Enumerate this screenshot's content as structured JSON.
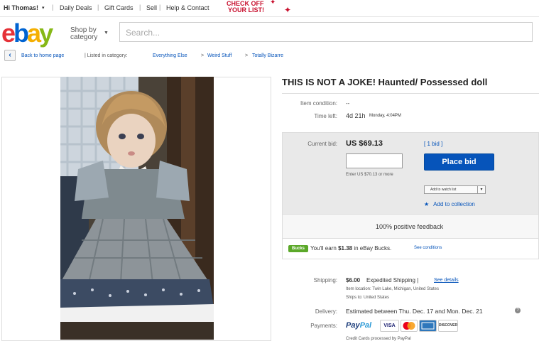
{
  "topbar": {
    "greeting": "Hi Thomas!",
    "greeting_caret": "▾",
    "links": [
      "Daily Deals",
      "Gift Cards",
      "Sell",
      "Help & Contact"
    ],
    "promo_line1": "CHECK OFF",
    "promo_line2": "YOUR LIST!"
  },
  "header": {
    "logo_letters": [
      "e",
      "b",
      "a",
      "y"
    ],
    "logo_colors": [
      "#e53238",
      "#0064d2",
      "#f5af02",
      "#86b817"
    ],
    "shop_by_line1": "Shop by",
    "shop_by_line2": "category",
    "search_placeholder": "Search..."
  },
  "breadcrumb": {
    "back_label": "Back to home page",
    "listed_label": "| Listed in category:",
    "categories": [
      "Everything Else",
      "Weird Stuff",
      "Totally Bizarre"
    ],
    "separator": ">"
  },
  "item": {
    "title": "THIS IS NOT A JOKE! Haunted/ Possessed doll",
    "condition_label": "Item condition:",
    "condition_value": "--",
    "time_left_label": "Time left:",
    "time_left_value": "4d 21h",
    "time_left_detail": "Monday, 4:04PM"
  },
  "bid": {
    "current_bid_label": "Current bid:",
    "current_bid_value": "US $69.13",
    "bid_count": "[ 1 bid ]",
    "input_value": "",
    "place_bid_label": "Place bid",
    "enter_hint": "Enter US $70.13 or more",
    "watch_label": "Add to watch list",
    "collection_label": "Add to collection"
  },
  "feedback": "100% positive feedback",
  "bucks": {
    "badge": "Bucks",
    "text_prefix": "You'll earn",
    "amount": "$1.38",
    "text_suffix": "in eBay Bucks.",
    "conditions": "See conditions"
  },
  "shipping": {
    "label": "Shipping:",
    "price": "$6.00",
    "method": "Expedited Shipping |",
    "details_link": "See details",
    "location_line": "Item location:  Twin Lake, Michigan, United States",
    "ships_to_line": "Ships to:  United States"
  },
  "delivery": {
    "label": "Delivery:",
    "value": "Estimated between Thu. Dec. 17 and Mon. Dec. 21"
  },
  "payments": {
    "label": "Payments:",
    "paypal_a": "Pay",
    "paypal_b": "Pal",
    "cards": [
      "VISA",
      "",
      "",
      "DISCOVER"
    ],
    "note": "Credit Cards processed by PayPal"
  },
  "colors": {
    "link": "#0654ba",
    "button": "#0654ba",
    "bucks_green": "#5ba829"
  }
}
